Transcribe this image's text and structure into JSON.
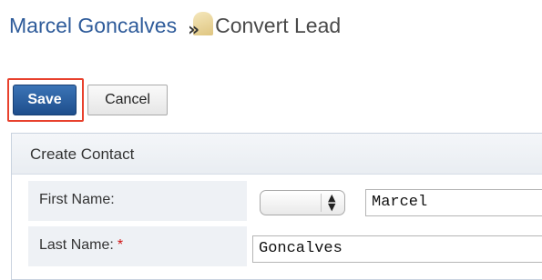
{
  "header": {
    "record_name": "Marcel Goncalves",
    "separator": "»",
    "page_title": "Convert Lead"
  },
  "buttons": {
    "save": "Save",
    "cancel": "Cancel"
  },
  "panel": {
    "title": "Create Contact",
    "fields": {
      "first_name_label": "First Name:",
      "salutation_value": "",
      "first_name_value": "Marcel",
      "last_name_label": "Last Name:",
      "required_marker": "*",
      "last_name_value": "Goncalves"
    }
  },
  "colors": {
    "link": "#2e5b9a",
    "save_button": "#2a5d9f",
    "highlight": "#e8412d",
    "required": "#d01212"
  }
}
